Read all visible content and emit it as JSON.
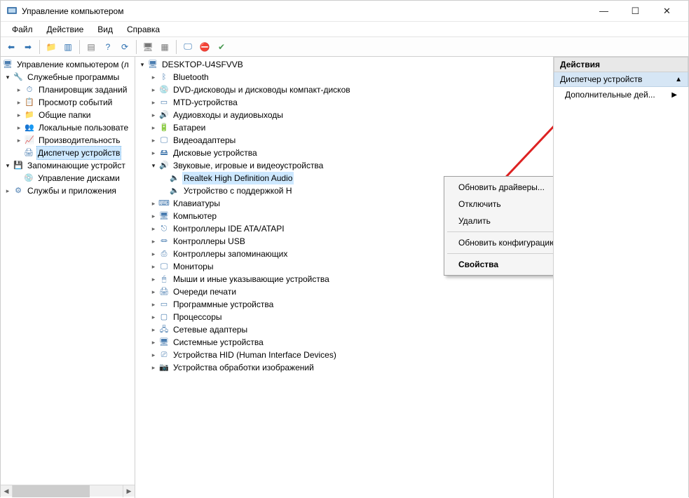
{
  "window": {
    "title": "Управление компьютером",
    "min": "—",
    "max": "☐",
    "close": "✕"
  },
  "menubar": [
    "Файл",
    "Действие",
    "Вид",
    "Справка"
  ],
  "left_tree": {
    "root": "Управление компьютером (л",
    "tools_group": "Служебные программы",
    "tools": [
      "Планировщик заданий",
      "Просмотр событий",
      "Общие папки",
      "Локальные пользовате",
      "Производительность",
      "Диспетчер устройств"
    ],
    "storage_group": "Запоминающие устройст",
    "storage": [
      "Управление дисками"
    ],
    "services": "Службы и приложения"
  },
  "center_tree": {
    "root": "DESKTOP-U4SFVVB",
    "items": [
      "Bluetooth",
      "DVD-дисководы и дисководы компакт-дисков",
      "MTD-устройства",
      "Аудиовходы и аудиовыходы",
      "Батареи",
      "Видеоадаптеры",
      "Дисковые устройства"
    ],
    "sound_group": "Звуковые, игровые и видеоустройства",
    "sound_children": [
      "Realtek High Definition Audio",
      "Устройство с поддержкой H"
    ],
    "items2": [
      "Клавиатуры",
      "Компьютер",
      "Контроллеры IDE ATA/ATAPI",
      "Контроллеры USB",
      "Контроллеры запоминающих",
      "Мониторы",
      "Мыши и иные указывающие устройства",
      "Очереди печати",
      "Программные устройства",
      "Процессоры",
      "Сетевые адаптеры",
      "Системные устройства",
      "Устройства HID (Human Interface Devices)",
      "Устройства обработки изображений"
    ]
  },
  "context_menu": {
    "update": "Обновить драйверы...",
    "disable": "Отключить",
    "remove": "Удалить",
    "refresh": "Обновить конфигурацию оборудования",
    "props": "Свойства"
  },
  "actions": {
    "header": "Действия",
    "section": "Диспетчер устройств",
    "more": "Дополнительные дей..."
  }
}
